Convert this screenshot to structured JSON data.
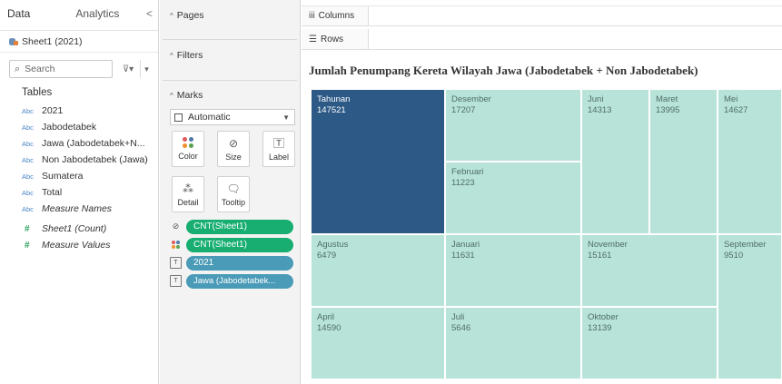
{
  "data_pane": {
    "tabs": [
      "Data",
      "Analytics"
    ],
    "collapse_glyph": "<",
    "datasource": "Sheet1 (2021)",
    "search_placeholder": "Search",
    "filter_glyph": "⊽▾",
    "menu_glyph": "▾",
    "tables_heading": "Tables",
    "fields": [
      {
        "type": "Abc",
        "label": "2021",
        "italic": false
      },
      {
        "type": "Abc",
        "label": "Jabodetabek",
        "italic": false
      },
      {
        "type": "Abc",
        "label": "Jawa (Jabodetabek+N...",
        "italic": false
      },
      {
        "type": "Abc",
        "label": "Non Jabodetabek (Jawa)",
        "italic": false
      },
      {
        "type": "Abc",
        "label": "Sumatera",
        "italic": false
      },
      {
        "type": "Abc",
        "label": "Total",
        "italic": false
      },
      {
        "type": "Abc",
        "label": "Measure Names",
        "italic": true
      },
      {
        "type": "#",
        "label": "Sheet1 (Count)",
        "italic": true
      },
      {
        "type": "#",
        "label": "Measure Values",
        "italic": true
      }
    ]
  },
  "cards": {
    "pages_title": "Pages",
    "filters_title": "Filters",
    "marks_title": "Marks",
    "mark_type": "Automatic",
    "buttons": {
      "color": "Color",
      "size": "Size",
      "label": "Label",
      "detail": "Detail",
      "tooltip": "Tooltip"
    },
    "pills": [
      {
        "icon": "size-icon",
        "label": "CNT(Sheet1)",
        "color": "green"
      },
      {
        "icon": "color-icon",
        "label": "CNT(Sheet1)",
        "color": "green"
      },
      {
        "icon": "label-icon",
        "label": "2021",
        "color": "blue"
      },
      {
        "icon": "label-icon",
        "label": "Jawa (Jabodetabek...",
        "color": "blue"
      }
    ]
  },
  "shelves": {
    "columns_label": "Columns",
    "rows_label": "Rows"
  },
  "view": {
    "title": "Jumlah Penumpang Kereta Wilayah Jawa (Jabodetabek + Non Jabodetabek)",
    "cells": [
      {
        "month": "Tahunan",
        "value": "147521",
        "highlight": true
      },
      {
        "month": "Desember",
        "value": "17207",
        "highlight": false
      },
      {
        "month": "Februari",
        "value": "11223",
        "highlight": false
      },
      {
        "month": "Juni",
        "value": "14313",
        "highlight": false
      },
      {
        "month": "Maret",
        "value": "13995",
        "highlight": false
      },
      {
        "month": "Mei",
        "value": "14627",
        "highlight": false
      },
      {
        "month": "Agustus",
        "value": "6479",
        "highlight": false
      },
      {
        "month": "Januari",
        "value": "11631",
        "highlight": false
      },
      {
        "month": "November",
        "value": "15161",
        "highlight": false
      },
      {
        "month": "September",
        "value": "9510",
        "highlight": false
      },
      {
        "month": "April",
        "value": "14590",
        "highlight": false
      },
      {
        "month": "Juli",
        "value": "5646",
        "highlight": false
      },
      {
        "month": "Oktober",
        "value": "13139",
        "highlight": false
      }
    ]
  },
  "colors": {
    "highlight_cell": "#2c5985",
    "cell": "#b8e3d8",
    "pill_green": "#18ae72",
    "pill_blue": "#4a9bb7"
  }
}
